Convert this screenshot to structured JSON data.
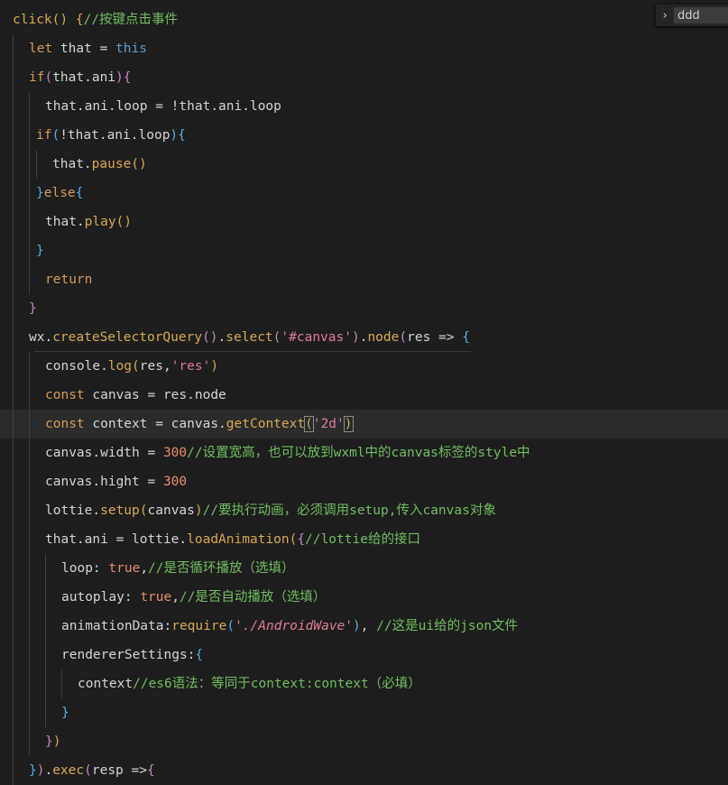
{
  "find_widget": {
    "toggle_icon": "›",
    "query": "ddd"
  },
  "code_lines": [
    {
      "guides": [],
      "segments": [
        [
          "fn",
          "click"
        ],
        [
          "br1",
          "()"
        ],
        [
          "plain",
          " "
        ],
        [
          "br1",
          "{"
        ],
        [
          "cm",
          "//按键点击事件"
        ]
      ]
    },
    {
      "guides": [
        14
      ],
      "segments": [
        [
          "kw",
          "let"
        ],
        [
          "plain",
          " that = "
        ],
        [
          "kw2",
          "this"
        ]
      ]
    },
    {
      "guides": [
        14
      ],
      "segments": [
        [
          "kw",
          "if"
        ],
        [
          "br2",
          "("
        ],
        [
          "plain",
          "that.ani"
        ],
        [
          "br2",
          ")"
        ],
        [
          "br2",
          "{"
        ]
      ]
    },
    {
      "guides": [
        14,
        32
      ],
      "segments": [
        [
          "plain",
          "that.ani.loop = !that.ani.loop"
        ]
      ]
    },
    {
      "guides": [
        14,
        32
      ],
      "segments": [
        [
          "kw",
          "if"
        ],
        [
          "br3",
          "("
        ],
        [
          "plain",
          "!that.ani.loop"
        ],
        [
          "br3",
          ")"
        ],
        [
          "br3",
          "{"
        ]
      ]
    },
    {
      "guides": [
        14,
        32,
        40
      ],
      "segments": [
        [
          "plain",
          "that."
        ],
        [
          "fn",
          "pause"
        ],
        [
          "br1",
          "()"
        ]
      ]
    },
    {
      "guides": [
        14,
        32
      ],
      "segments": [
        [
          "br3",
          "}"
        ],
        [
          "kw",
          "else"
        ],
        [
          "br3",
          "{"
        ]
      ]
    },
    {
      "guides": [
        14,
        32
      ],
      "segments": [
        [
          "plain",
          "that."
        ],
        [
          "fn",
          "play"
        ],
        [
          "br1",
          "()"
        ]
      ]
    },
    {
      "guides": [
        14,
        32
      ],
      "segments": [
        [
          "br3",
          "}"
        ]
      ]
    },
    {
      "guides": [
        14,
        32
      ],
      "segments": [
        [
          "kw",
          "return"
        ]
      ]
    },
    {
      "guides": [
        14
      ],
      "segments": [
        [
          "br2",
          "}"
        ]
      ]
    },
    {
      "guides": [
        14
      ],
      "segments": [
        [
          "plain",
          "wx."
        ],
        [
          "fn",
          "createSelectorQuery"
        ],
        [
          "br2",
          "()"
        ],
        [
          "plain",
          "."
        ],
        [
          "fn",
          "select"
        ],
        [
          "br2",
          "("
        ],
        [
          "str",
          "'#canvas'"
        ],
        [
          "br2",
          ")"
        ],
        [
          "plain",
          "."
        ],
        [
          "fn",
          "node"
        ],
        [
          "br2",
          "("
        ],
        [
          "plain",
          "res => "
        ],
        [
          "br3",
          "{"
        ]
      ]
    },
    {
      "guides": [
        14,
        32
      ],
      "segments": [
        [
          "plain",
          "console."
        ],
        [
          "fn",
          "log"
        ],
        [
          "br1",
          "("
        ],
        [
          "plain",
          "res,"
        ],
        [
          "str",
          "'res'"
        ],
        [
          "br1",
          ")"
        ]
      ]
    },
    {
      "guides": [
        14,
        32
      ],
      "segments": [
        [
          "kw",
          "const"
        ],
        [
          "plain",
          " canvas = res.node"
        ]
      ]
    },
    {
      "guides": [
        14,
        32
      ],
      "current": true,
      "segments": [
        [
          "kw",
          "const"
        ],
        [
          "plain",
          " context = canvas."
        ],
        [
          "fn",
          "getContext"
        ],
        [
          "br1box",
          "("
        ],
        [
          "str",
          "'2d'"
        ],
        [
          "br1box",
          ")"
        ]
      ]
    },
    {
      "guides": [
        14,
        32
      ],
      "segments": [
        [
          "plain",
          "canvas.width = "
        ],
        [
          "num",
          "300"
        ],
        [
          "cm",
          "//设置宽高，也可以放到wxml中的canvas标签的style中"
        ]
      ]
    },
    {
      "guides": [
        14,
        32
      ],
      "segments": [
        [
          "plain",
          "canvas.hight = "
        ],
        [
          "num",
          "300"
        ]
      ]
    },
    {
      "guides": [
        14,
        32
      ],
      "segments": [
        [
          "plain",
          "lottie."
        ],
        [
          "fn",
          "setup"
        ],
        [
          "br1",
          "("
        ],
        [
          "plain",
          "canvas"
        ],
        [
          "br1",
          ")"
        ],
        [
          "cm",
          "//要执行动画，必须调用setup,传入canvas对象"
        ]
      ]
    },
    {
      "guides": [
        14,
        32
      ],
      "segments": [
        [
          "plain",
          "that.ani = lottie."
        ],
        [
          "fn",
          "loadAnimation"
        ],
        [
          "br1",
          "("
        ],
        [
          "br2",
          "{"
        ],
        [
          "cm",
          "//lottie给的接口"
        ]
      ]
    },
    {
      "guides": [
        14,
        32,
        50
      ],
      "segments": [
        [
          "plain",
          "loop: "
        ],
        [
          "bool",
          "true"
        ],
        [
          "plain",
          ","
        ],
        [
          "cm",
          "//是否循环播放（选填）"
        ]
      ]
    },
    {
      "guides": [
        14,
        32,
        50
      ],
      "segments": [
        [
          "plain",
          "autoplay: "
        ],
        [
          "bool",
          "true"
        ],
        [
          "plain",
          ","
        ],
        [
          "cm",
          "//是否自动播放（选填）"
        ]
      ]
    },
    {
      "guides": [
        14,
        32,
        50
      ],
      "segments": [
        [
          "plain",
          "animationData:"
        ],
        [
          "fn",
          "require"
        ],
        [
          "br3",
          "("
        ],
        [
          "strit",
          "'./AndroidWave'"
        ],
        [
          "br3",
          ")"
        ],
        [
          "plain",
          ", "
        ],
        [
          "cm",
          "//这是ui给的json文件"
        ]
      ]
    },
    {
      "guides": [
        14,
        32,
        50
      ],
      "segments": [
        [
          "plain",
          "rendererSettings:"
        ],
        [
          "br3",
          "{"
        ]
      ]
    },
    {
      "guides": [
        14,
        32,
        50,
        68
      ],
      "segments": [
        [
          "plain",
          "context"
        ],
        [
          "cm",
          "//es6语法：等同于context:context（必填）"
        ]
      ]
    },
    {
      "guides": [
        14,
        32,
        50
      ],
      "segments": [
        [
          "br3",
          "}"
        ]
      ]
    },
    {
      "guides": [
        14,
        32
      ],
      "segments": [
        [
          "br2",
          "}"
        ],
        [
          "br1",
          ")"
        ]
      ]
    },
    {
      "guides": [
        14
      ],
      "segments": [
        [
          "br3",
          "}"
        ],
        [
          "br2",
          ")"
        ],
        [
          "plain",
          "."
        ],
        [
          "fn",
          "exec"
        ],
        [
          "br2",
          "("
        ],
        [
          "plain",
          "resp =>"
        ],
        [
          "br2",
          "{"
        ]
      ]
    }
  ],
  "indents": [
    14,
    32,
    32,
    50,
    40,
    58,
    40,
    50,
    40,
    50,
    32,
    32,
    50,
    50,
    50,
    50,
    50,
    50,
    50,
    68,
    68,
    68,
    68,
    86,
    68,
    50,
    32
  ]
}
